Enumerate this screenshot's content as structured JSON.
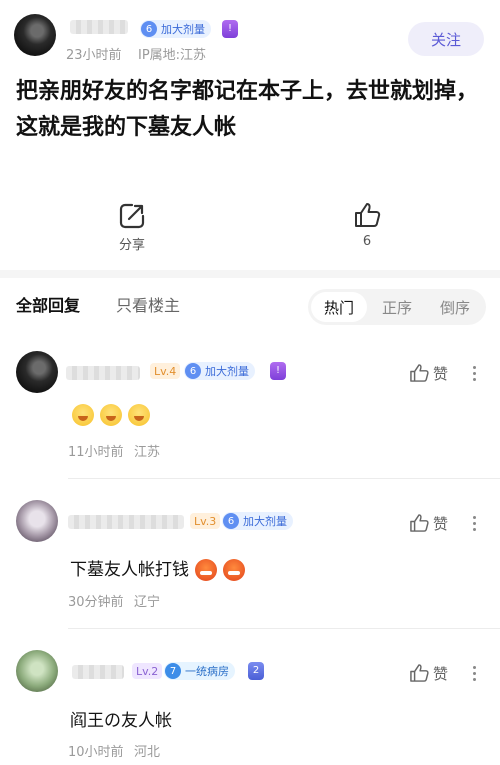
{
  "post": {
    "level_pill": {
      "num": "6",
      "label": "加大剂量"
    },
    "badge": "!",
    "time": "23小时前",
    "ip": "IP属地:江苏",
    "follow_label": "关注",
    "title": "把亲朋好友的名字都记在本子上，去世就划掉，这就是我的下墓友人帐",
    "actions": {
      "share_label": "分享",
      "like_count": "6"
    }
  },
  "tabs": {
    "all": "全部回复",
    "owner_only": "只看楼主"
  },
  "sort": {
    "hot": "热门",
    "asc": "正序",
    "desc": "倒序"
  },
  "comments": [
    {
      "level": "Lv.4",
      "pill_num": "6",
      "pill_label": "加大剂量",
      "badge": "!",
      "time": "11小时前",
      "location": "江苏",
      "like_label": "赞"
    },
    {
      "level": "Lv.3",
      "pill_num": "6",
      "pill_label": "加大剂量",
      "text": "下墓友人帐打钱",
      "time": "30分钟前",
      "location": "辽宁",
      "like_label": "赞"
    },
    {
      "level": "Lv.2",
      "pill_num": "7",
      "pill_label": "一统病房",
      "badge": "2",
      "text": "阎王の友人帐",
      "time": "10小时前",
      "location": "河北",
      "like_label": "赞"
    }
  ],
  "colors": {
    "accent": "#5b5ad6",
    "follow_bg": "#efeefa"
  }
}
